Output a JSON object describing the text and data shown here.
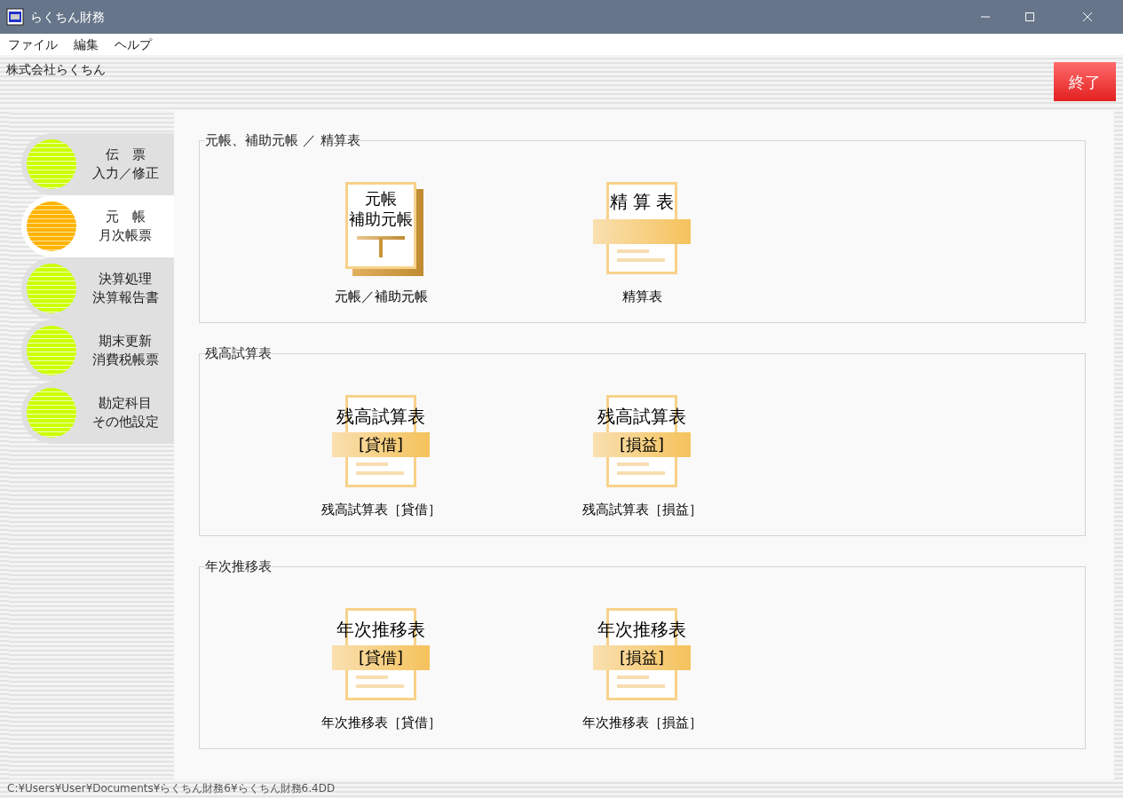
{
  "window": {
    "title": "らくちん財務"
  },
  "menu": [
    "ファイル",
    "編集",
    "ヘルプ"
  ],
  "header": {
    "company": "株式会社らくちん",
    "exit_button": "終了"
  },
  "sidebar": {
    "items": [
      {
        "line1": "伝　票",
        "line2": "入力／修正",
        "selected": false
      },
      {
        "line1": "元　帳",
        "line2": "月次帳票",
        "selected": true
      },
      {
        "line1": "決算処理",
        "line2": "決算報告書",
        "selected": false
      },
      {
        "line1": "期末更新",
        "line2": "消費税帳票",
        "selected": false
      },
      {
        "line1": "勘定科目",
        "line2": "その他設定",
        "selected": false
      }
    ]
  },
  "sections": [
    {
      "title": "元帳、補助元帳 ／ 精算表",
      "items": [
        {
          "kind": "ledger",
          "icon_lines": [
            "元帳",
            "補助元帳"
          ],
          "label": "元帳／補助元帳"
        },
        {
          "kind": "sheet",
          "icon_title": "精 算 表",
          "label": "精算表"
        }
      ]
    },
    {
      "title": "残高試算表",
      "items": [
        {
          "kind": "report",
          "icon_title": "残高試算表",
          "icon_band": "[貸借]",
          "label": "残高試算表［貸借］"
        },
        {
          "kind": "report",
          "icon_title": "残高試算表",
          "icon_band": "[損益]",
          "label": "残高試算表［損益］"
        }
      ]
    },
    {
      "title": "年次推移表",
      "items": [
        {
          "kind": "report",
          "icon_title": "年次推移表",
          "icon_band": "[貸借]",
          "label": "年次推移表［貸借］"
        },
        {
          "kind": "report",
          "icon_title": "年次推移表",
          "icon_band": "[損益]",
          "label": "年次推移表［損益］"
        }
      ]
    }
  ],
  "status_bar": {
    "path": "C:¥Users¥User¥Documents¥らくちん財務6¥らくちん財務6.4DD"
  }
}
